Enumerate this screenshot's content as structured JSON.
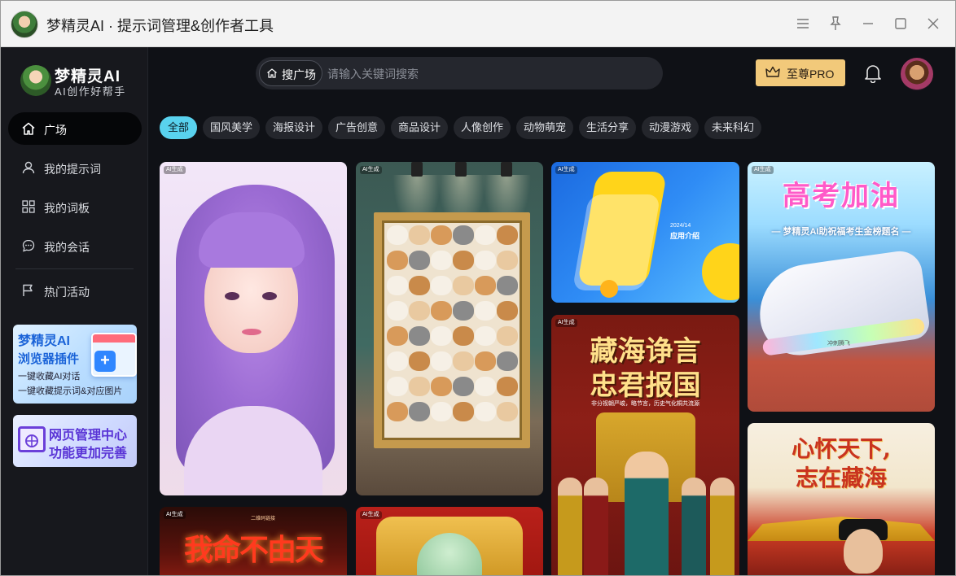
{
  "window": {
    "title": "梦精灵AI · 提示词管理&创作者工具",
    "controls": [
      "menu-icon",
      "pin-icon",
      "minimize-icon",
      "maximize-icon",
      "close-icon"
    ]
  },
  "brand": {
    "name": "梦精灵AI",
    "tagline": "AI创作好帮手"
  },
  "sidebar": {
    "items": [
      {
        "label": "广场",
        "icon": "home-icon",
        "active": true
      },
      {
        "label": "我的提示词",
        "icon": "user-icon",
        "active": false
      },
      {
        "label": "我的词板",
        "icon": "grid-icon",
        "active": false
      },
      {
        "label": "我的会话",
        "icon": "chat-icon",
        "active": false
      },
      {
        "label": "热门活动",
        "icon": "flag-icon",
        "active": false
      }
    ],
    "promos": [
      {
        "title": "梦精灵AI",
        "subtitle": "浏览器插件",
        "lines": [
          "一键收藏AI对话",
          "一键收藏提示词&对应图片"
        ]
      },
      {
        "lines": [
          "网页管理中心",
          "功能更加完善"
        ]
      }
    ]
  },
  "header": {
    "search_scope": "搜广场",
    "search_placeholder": "请输入关键词搜索",
    "pro_label": "至尊PRO"
  },
  "categories": [
    "全部",
    "国风美学",
    "海报设计",
    "广告创意",
    "商品设计",
    "人像创作",
    "动物萌宠",
    "生活分享",
    "动漫游戏",
    "未来科幻"
  ],
  "active_category": "全部",
  "cards": [
    {
      "badge": "AI生成",
      "subject": "purple-haired portrait"
    },
    {
      "badge": "AI生成",
      "subject": "framed puppy wall art"
    },
    {
      "badge": "AI生成",
      "subject": "app intro graphic",
      "small": "2024/14",
      "text": "应用介绍"
    },
    {
      "badge": "AI生成",
      "subject": "sneaker poster",
      "title": "高考加油",
      "subtitle": "— 梦精灵AI助祝福考生金榜题名 —",
      "tag": "冲刺腾飞"
    },
    {
      "badge": "AI生成",
      "subject": "imperial court poster",
      "title_lines": [
        "藏海诤言",
        "忠君报国"
      ],
      "subtitle": "非分视朝严峻，略节言，历史气化桐共流源"
    },
    {
      "badge": "AI生成",
      "subject": "palace poster",
      "title_lines": [
        "心怀天下,",
        "志在藏海"
      ]
    },
    {
      "badge": "AI生成",
      "subject": "fire calligraphy poster",
      "title": "我命不由天",
      "small": "二维码链接"
    },
    {
      "badge": "AI生成",
      "subject": "jade carving"
    }
  ]
}
